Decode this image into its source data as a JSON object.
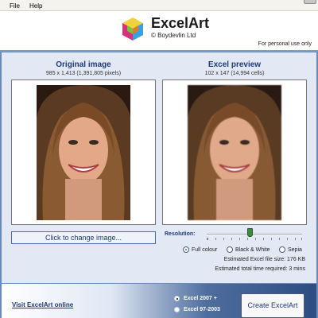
{
  "menu": {
    "file": "File",
    "help": "Help"
  },
  "header": {
    "app_name": "ExcelArt",
    "copyright": "© Boydevlin Ltd",
    "license_note": "For personal use only"
  },
  "original": {
    "title": "Original image",
    "dimensions": "985 x 1,413 (1,391,805 pixels)"
  },
  "preview": {
    "title": "Excel preview",
    "dimensions": "102 x 147 (14,994 cells)"
  },
  "change_image_label": "Click to change image...",
  "resolution": {
    "label": "Resolution:",
    "level": 0.45
  },
  "colour_modes": {
    "selected": "Full colour",
    "options": [
      "Full colour",
      "Black & White",
      "Sepia"
    ]
  },
  "estimates": {
    "file_size": "Estimated Excel file size: 176 KB",
    "time": "Estimated total time required: 3 mins"
  },
  "bottom": {
    "visit_link": "Visit ExcelArt online",
    "versions": [
      "Excel 2007 +",
      "Excel 97-2003"
    ],
    "selected_version": "Excel 2007 +",
    "create_label": "Create ExcelArt"
  },
  "colors": {
    "accent": "#1e3a7a",
    "panel_bg": "#e3e9f4",
    "slider_thumb": "#3e8a3e"
  }
}
